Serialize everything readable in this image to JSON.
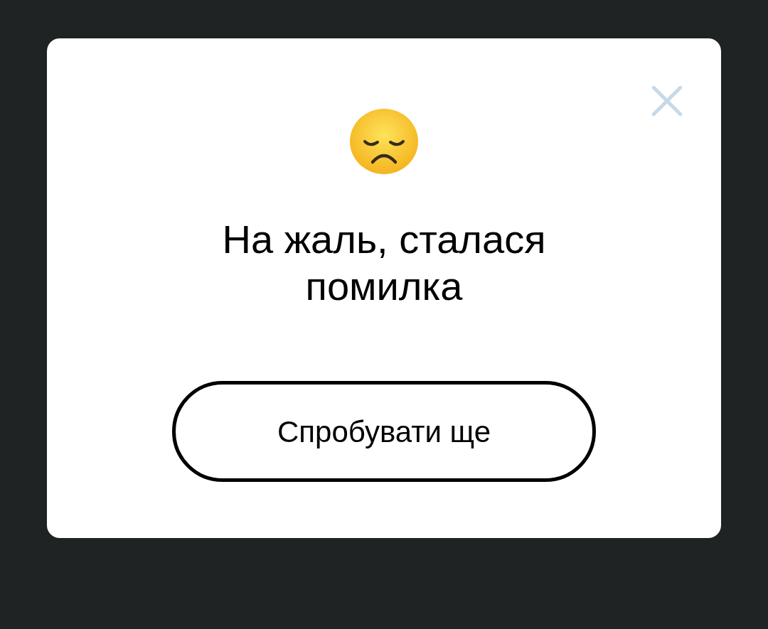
{
  "dialog": {
    "title": "На жаль, сталася помилка",
    "button": "Спробувати ще"
  }
}
